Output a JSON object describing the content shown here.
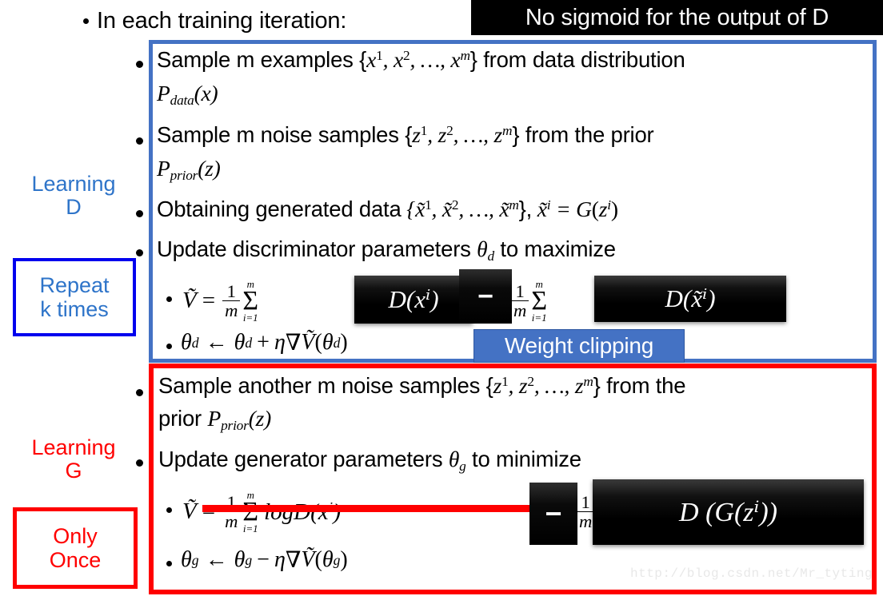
{
  "colors": {
    "blue_box": "#4472C4",
    "blue_text": "#2E74C9",
    "blue_border_strong": "#0000EE",
    "red": "#FF0000",
    "black": "#000000",
    "watermark": "#E8E8E8"
  },
  "header": {
    "intro_text": "In each training iteration:",
    "banner_text": "No sigmoid for the output of D"
  },
  "sidebar": {
    "learning_d": {
      "label_line1": "Learning",
      "label_line2": "D",
      "box_line1": "Repeat",
      "box_line2": "k times"
    },
    "learning_g": {
      "label_line1": "Learning",
      "label_line2": "G",
      "box_line1": "Only",
      "box_line2": "Once"
    }
  },
  "learning_d_steps": [
    {
      "id": "sample-m-examples",
      "line1_a": "Sample m examples {",
      "line1_var": "x",
      "line1_b": " from data distribution",
      "line2_p": "P",
      "line2_sub": "data",
      "line2_arg": "(x)"
    },
    {
      "id": "sample-m-noise",
      "line1_a": "Sample m noise samples {",
      "line1_var": "z",
      "line1_b": " from the prior",
      "line2_p": "P",
      "line2_sub": "prior",
      "line2_arg": "(z)"
    },
    {
      "id": "obtaining-generated-data",
      "text": "Obtaining generated data"
    },
    {
      "id": "update-discriminator",
      "text_a": "Update discriminator parameters ",
      "theta": "θ",
      "theta_sub": "d",
      "text_b": " to maximize"
    }
  ],
  "learning_g_steps": [
    {
      "id": "sample-another-m-noise",
      "line1_a": "Sample another m noise samples {",
      "line1_var": "z",
      "line1_b": " from the",
      "line2_a": "prior ",
      "line2_p": "P",
      "line2_sub": "prior",
      "line2_arg": "(z)"
    },
    {
      "id": "update-generator",
      "text_a": "Update generator parameters ",
      "theta": "θ",
      "theta_sub": "g",
      "text_b": " to minimize"
    }
  ],
  "formulas": {
    "d_objective": {
      "vtilde": "Ṽ",
      "equals": "=",
      "frac_num": "1",
      "frac_den": "m",
      "sigma_big": "Σ",
      "sigma_lower": "i=1",
      "sigma_upper": "m",
      "black_box_1": "D(xⁱ)",
      "black_box_minus": "−",
      "black_box_2": "D(x̃ⁱ)"
    },
    "d_update": {
      "text": "θ_d ← θ_d + η∇Ṽ(θ_d)",
      "theta": "θ",
      "theta_sub": "d",
      "arrow": "←",
      "plus": "+",
      "eta": "η",
      "nabla": "∇",
      "vtilde": "Ṽ"
    },
    "weight_clipping_label": "Weight clipping",
    "g_objective": {
      "vtilde": "Ṽ",
      "equals": "=",
      "frac_num": "1",
      "frac_den": "m",
      "sigma_big": "Σ",
      "sigma_lower": "i=1",
      "sigma_upper": "m",
      "struck_text": "logD(xⁱ)",
      "black_box_minus": "−",
      "black_box_2": "D (G(zⁱ))"
    },
    "g_update": {
      "theta": "θ",
      "theta_sub": "g",
      "arrow": "←",
      "minus": "−",
      "eta": "η",
      "nabla": "∇",
      "vtilde": "Ṽ"
    }
  },
  "sets": {
    "x_set": "{x¹, x², …, xᵐ}",
    "z_set": "{z¹, z², …, zᵐ}",
    "xtilde_set": "{x̃¹, x̃², …, x̃ᵐ}",
    "xtilde_def": "x̃ⁱ = G(zⁱ)"
  },
  "watermark": {
    "text": "http://blog.csdn.net/Mr_tyting"
  }
}
